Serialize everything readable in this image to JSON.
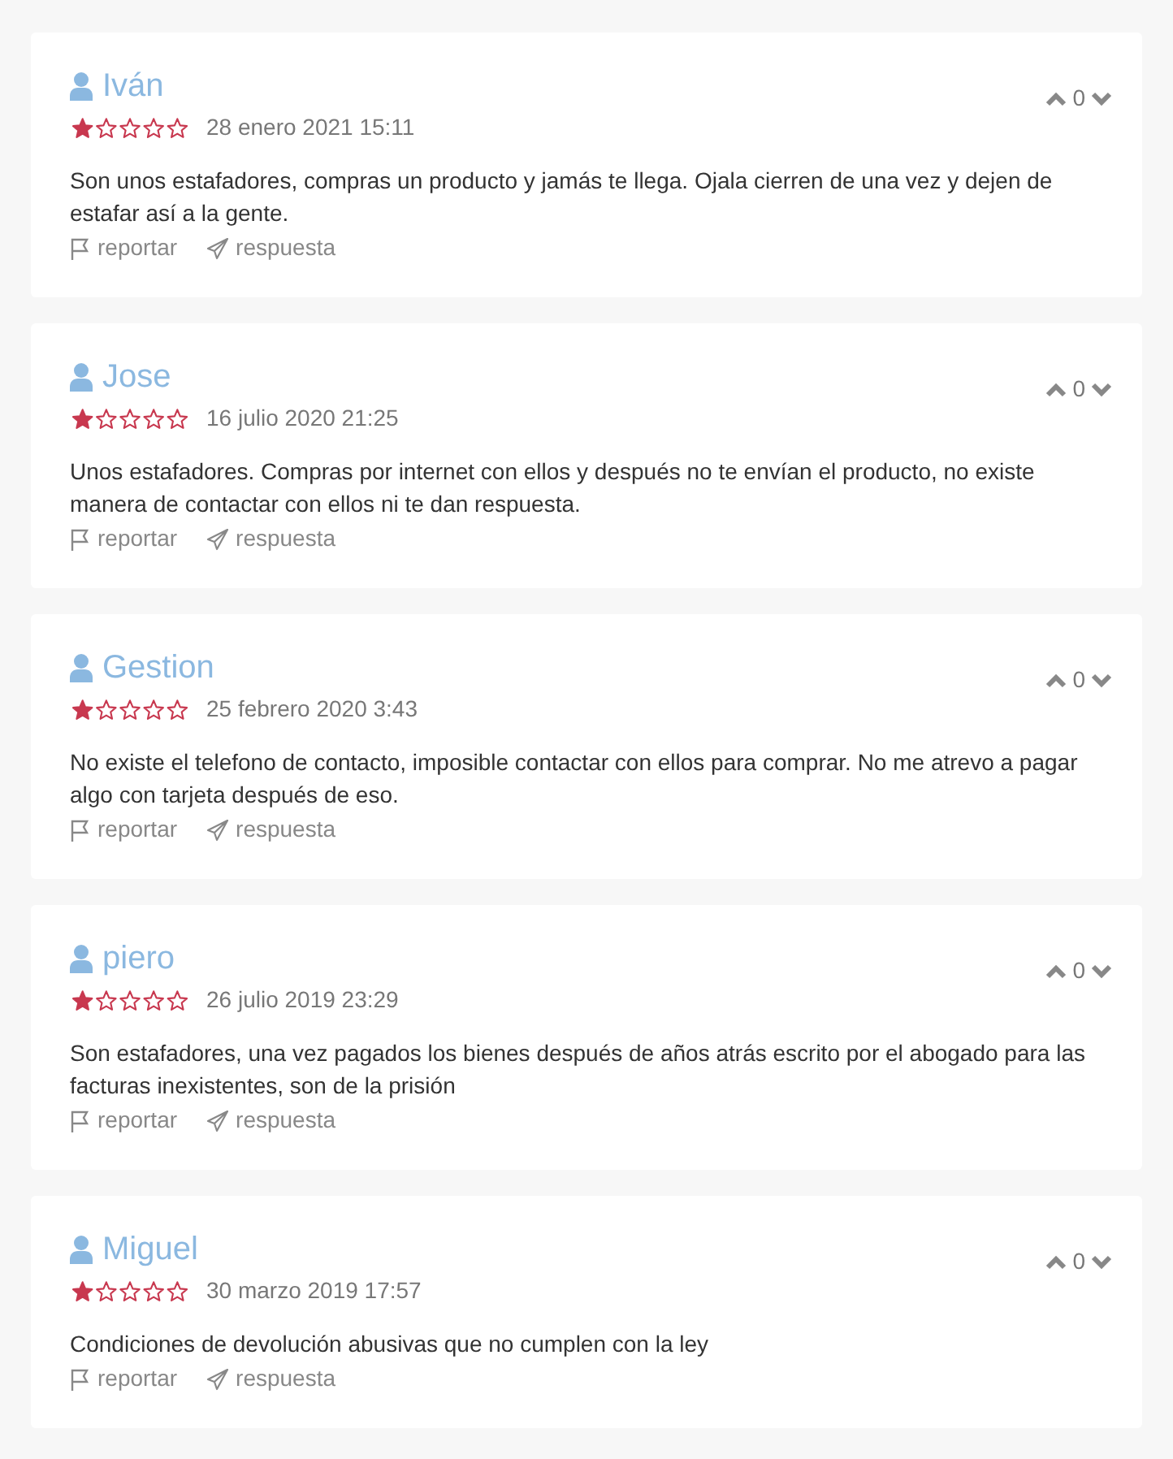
{
  "reviews": [
    {
      "author": "Iván",
      "stars": 1,
      "date": "28 enero 2021 15:11",
      "votes": "0",
      "text": "Son unos estafadores, compras un producto y jamás te llega. Ojala cierren de una vez y dejen de estafar así a la gente.",
      "report": "reportar",
      "reply": "respuesta"
    },
    {
      "author": "Jose",
      "stars": 1,
      "date": "16 julio 2020 21:25",
      "votes": "0",
      "text": "Unos estafadores. Compras por internet con ellos y después no te envían el producto, no existe manera de contactar con ellos ni te dan respuesta.",
      "report": "reportar",
      "reply": "respuesta"
    },
    {
      "author": "Gestion",
      "stars": 1,
      "date": "25 febrero 2020 3:43",
      "votes": "0",
      "text": "No existe el telefono de contacto, imposible contactar con ellos para comprar. No me atrevo a pagar algo con tarjeta después de eso.",
      "report": "reportar",
      "reply": "respuesta"
    },
    {
      "author": "piero",
      "stars": 1,
      "date": "26 julio 2019 23:29",
      "votes": "0",
      "text": "Son estafadores, una vez pagados los bienes después de años atrás escrito por el abogado para las facturas inexistentes, son de la prisión",
      "report": "reportar",
      "reply": "respuesta"
    },
    {
      "author": "Miguel",
      "stars": 1,
      "date": "30 marzo 2019 17:57",
      "votes": "0",
      "text": "Condiciones de devolución abusivas que no cumplen con la ley",
      "report": "reportar",
      "reply": "respuesta"
    }
  ]
}
